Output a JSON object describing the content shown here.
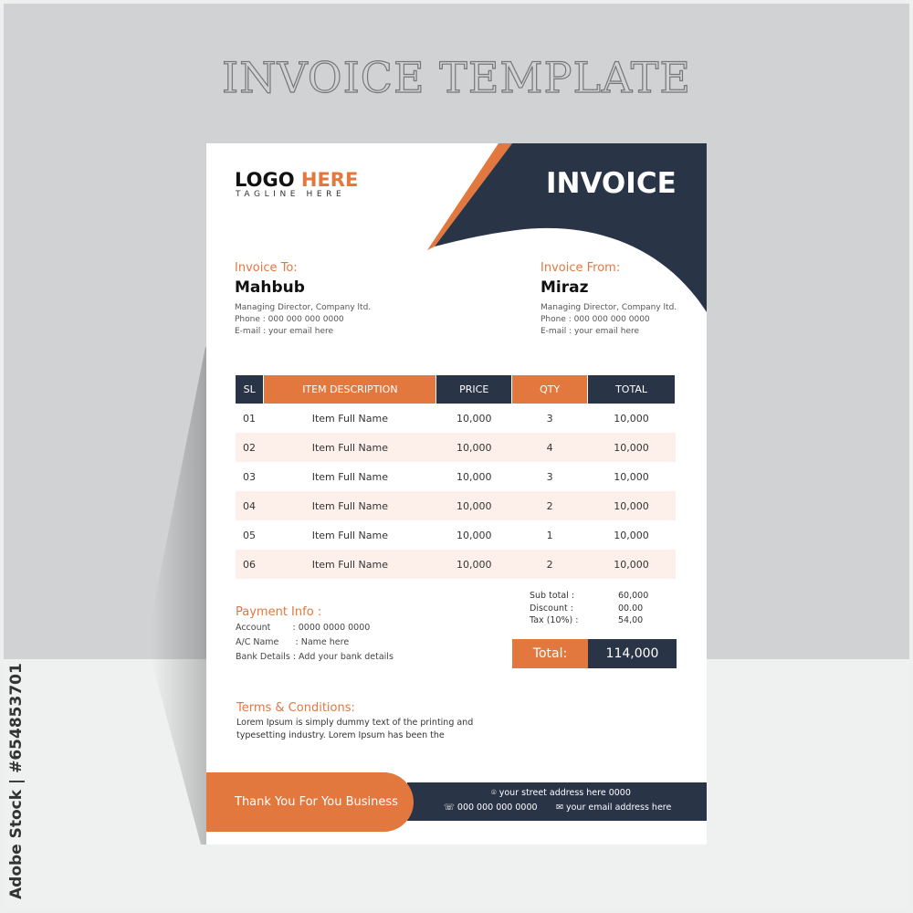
{
  "page_title": "INVOICE TEMPLATE",
  "watermark": "Adobe Stock | #654853701",
  "colors": {
    "accent": "#e3783e",
    "dark": "#2a3447"
  },
  "header": {
    "logo_main": "LOGO ",
    "logo_accent": "HERE",
    "tagline": "TAGLINE HERE",
    "title": "INVOICE"
  },
  "to": {
    "label": "Invoice To:",
    "name": "Mahbub",
    "role": "Managing Director, Company ltd.",
    "phone": "Phone : 000 000 000 0000",
    "email": "E-mail : your email here"
  },
  "from": {
    "label": "Invoice From:",
    "name": "Miraz",
    "role": "Managing Director, Company ltd.",
    "phone": "Phone : 000 000 000 0000",
    "email": "E-mail : your email here"
  },
  "table": {
    "headers": [
      "SL",
      "ITEM DESCRIPTION",
      "PRICE",
      "QTY",
      "TOTAL"
    ],
    "rows": [
      [
        "01",
        "Item Full Name",
        "10,000",
        "3",
        "10,000"
      ],
      [
        "02",
        "Item Full Name",
        "10,000",
        "4",
        "10,000"
      ],
      [
        "03",
        "Item Full Name",
        "10,000",
        "3",
        "10,000"
      ],
      [
        "04",
        "Item Full Name",
        "10,000",
        "2",
        "10,000"
      ],
      [
        "05",
        "Item Full Name",
        "10,000",
        "1",
        "10,000"
      ],
      [
        "06",
        "Item Full Name",
        "10,000",
        "2",
        "10,000"
      ]
    ]
  },
  "summary": {
    "sub_label": "Sub total :",
    "sub_value": "60,000",
    "disc_label": "Discount :",
    "disc_value": "00.00",
    "tax_label": "Tax (10%) :",
    "tax_value": "54,00",
    "total_label": "Total:",
    "total_value": "114,000"
  },
  "payment": {
    "title": "Payment Info :",
    "account": "Account        : 0000 0000 0000",
    "acname": "A/C Name      : Name here",
    "bank": "Bank Details : Add your bank details"
  },
  "terms": {
    "title": "Terms & Conditions:",
    "text": "Lorem Ipsum is simply dummy text of the printing and typesetting industry. Lorem Ipsum has been the"
  },
  "footer": {
    "thanks": "Thank You For You Business",
    "address": "your street address here 0000",
    "phone": "000 000 000 0000",
    "email": "your email address here"
  }
}
